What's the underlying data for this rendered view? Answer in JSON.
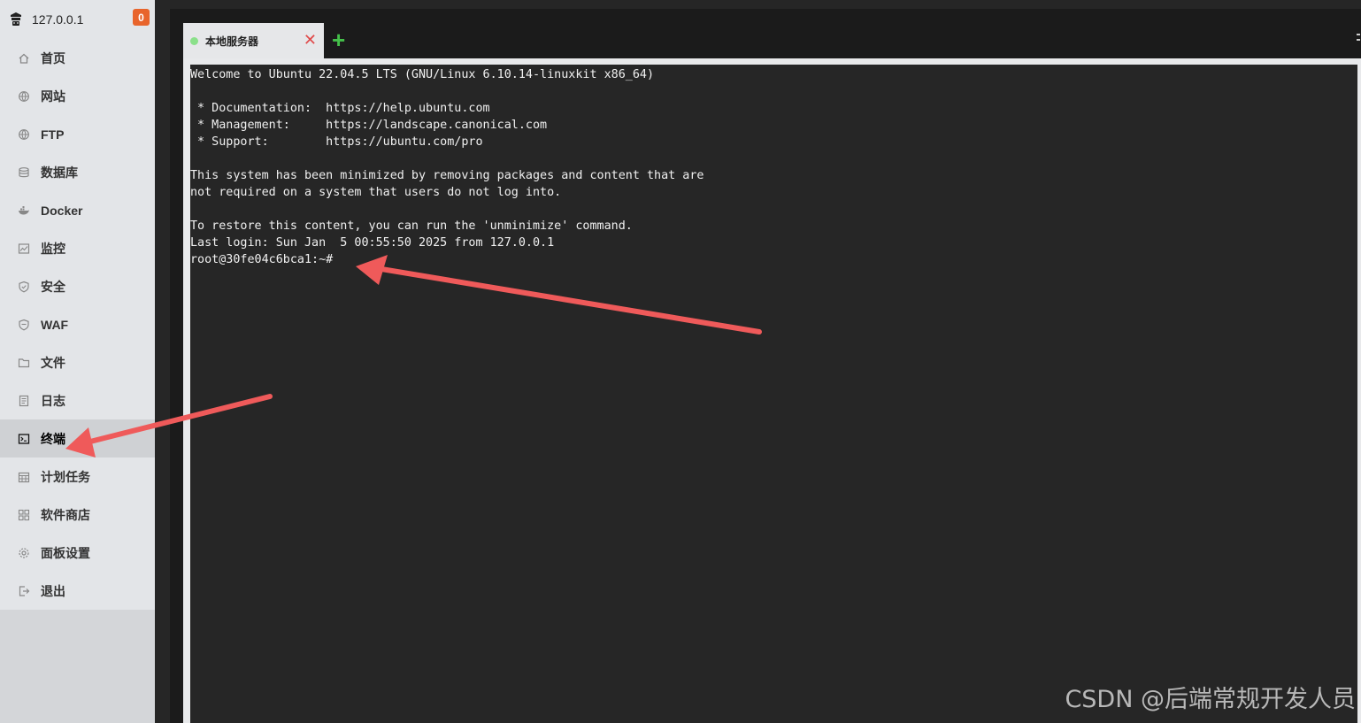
{
  "sidebar": {
    "host": "127.0.0.1",
    "badge": "0",
    "items": [
      {
        "label": "首页",
        "icon": "home-icon"
      },
      {
        "label": "网站",
        "icon": "globe-icon"
      },
      {
        "label": "FTP",
        "icon": "globe-icon"
      },
      {
        "label": "数据库",
        "icon": "database-icon"
      },
      {
        "label": "Docker",
        "icon": "docker-icon"
      },
      {
        "label": "监控",
        "icon": "monitor-icon"
      },
      {
        "label": "安全",
        "icon": "shield-icon"
      },
      {
        "label": "WAF",
        "icon": "waf-shield-icon"
      },
      {
        "label": "文件",
        "icon": "folder-icon"
      },
      {
        "label": "日志",
        "icon": "log-icon"
      },
      {
        "label": "终端",
        "icon": "terminal-icon",
        "active": true
      },
      {
        "label": "计划任务",
        "icon": "calendar-icon"
      },
      {
        "label": "软件商店",
        "icon": "grid-icon"
      },
      {
        "label": "面板设置",
        "icon": "gear-icon"
      },
      {
        "label": "退出",
        "icon": "logout-icon"
      }
    ]
  },
  "tabs": [
    {
      "label": "本地服务器",
      "status_color": "#8be08a"
    }
  ],
  "add_tab_label": "+",
  "close_tab_label": "✕",
  "terminal": {
    "lines": [
      "Welcome to Ubuntu 22.04.5 LTS (GNU/Linux 6.10.14-linuxkit x86_64)",
      "",
      " * Documentation:  https://help.ubuntu.com",
      " * Management:     https://landscape.canonical.com",
      " * Support:        https://ubuntu.com/pro",
      "",
      "This system has been minimized by removing packages and content that are",
      "not required on a system that users do not log into.",
      "",
      "To restore this content, you can run the 'unminimize' command.",
      "Last login: Sun Jan  5 00:55:50 2025 from 127.0.0.1",
      "root@30fe04c6bca1:~#"
    ]
  },
  "watermark": "CSDN @后端常规开发人员",
  "colors": {
    "annotation_arrow": "#ef5a5a",
    "badge": "#e8642b",
    "add_tab": "#44c04a"
  }
}
